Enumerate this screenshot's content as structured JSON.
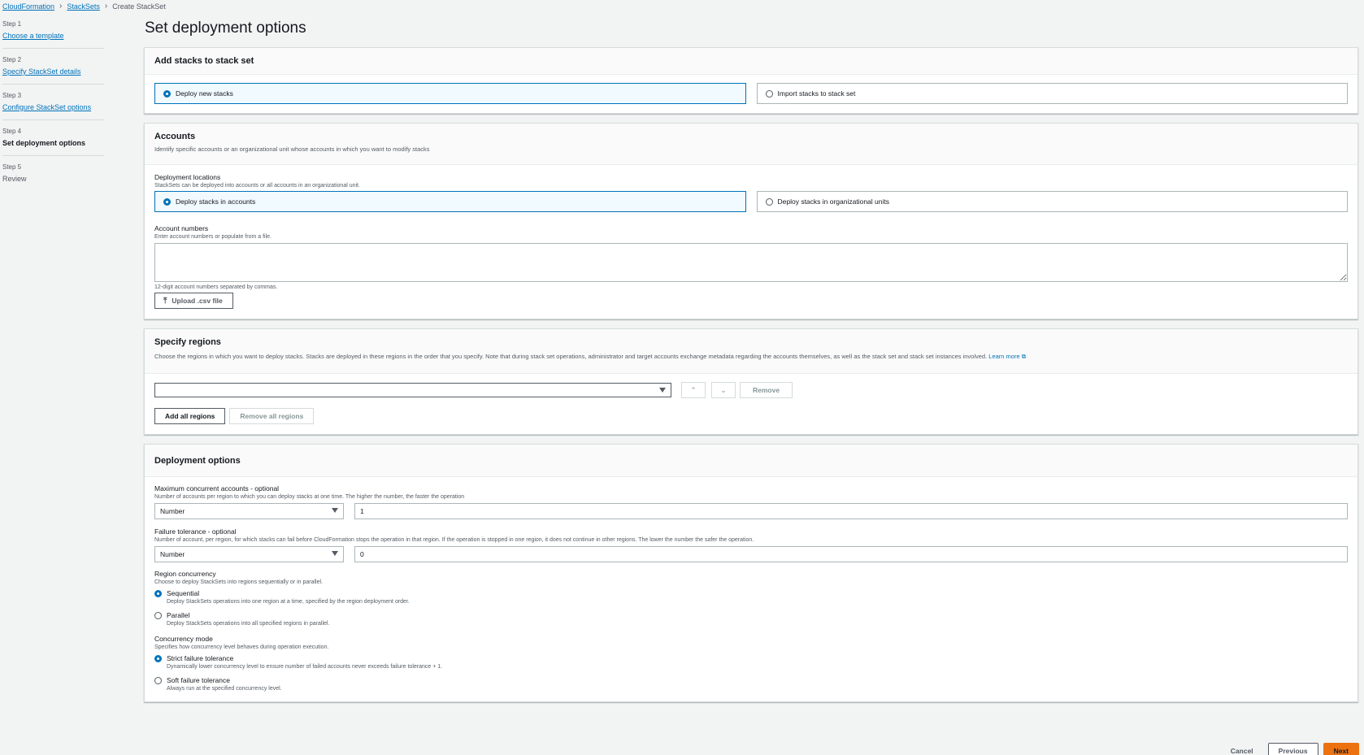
{
  "breadcrumb": {
    "item1": "CloudFormation",
    "item2": "StackSets",
    "current": "Create StackSet"
  },
  "steps": [
    {
      "num": "Step 1",
      "label": "Choose a template"
    },
    {
      "num": "Step 2",
      "label": "Specify StackSet details"
    },
    {
      "num": "Step 3",
      "label": "Configure StackSet options"
    },
    {
      "num": "Step 4",
      "label": "Set deployment options"
    },
    {
      "num": "Step 5",
      "label": "Review"
    }
  ],
  "page_title": "Set deployment options",
  "add_stacks": {
    "title": "Add stacks to stack set",
    "option_deploy": "Deploy new stacks",
    "option_import": "Import stacks to stack set"
  },
  "accounts": {
    "title": "Accounts",
    "desc": "Identify specific accounts or an organizational unit whose accounts in which you want to modify stacks",
    "locations_label": "Deployment locations",
    "locations_desc": "StackSets can be deployed into accounts or all accounts in an organizational unit.",
    "option_accounts": "Deploy stacks in accounts",
    "option_ou": "Deploy stacks in organizational units",
    "numbers_label": "Account numbers",
    "numbers_desc": "Enter account numbers or populate from a file.",
    "numbers_value": "",
    "numbers_constraint": "12-digit account numbers separated by commas.",
    "upload_button": "Upload .csv file"
  },
  "regions": {
    "title": "Specify regions",
    "desc": "Choose the regions in which you want to deploy stacks. Stacks are deployed in these regions in the order that you specify. Note that during stack set operations, administrator and target accounts exchange metadata regarding the accounts themselves, as well as the stack set and stack set instances involved.",
    "learn_more": "Learn more",
    "select_value": "",
    "remove_button": "Remove",
    "add_all_button": "Add all regions",
    "remove_all_button": "Remove all regions"
  },
  "deployment": {
    "title": "Deployment options",
    "max_label": "Maximum concurrent accounts - optional",
    "max_desc": "Number of accounts per region to which you can deploy stacks at one time. The higher the number, the faster the operation",
    "max_type": "Number",
    "max_value": "1",
    "fail_label": "Failure tolerance - optional",
    "fail_desc": "Number of account, per region, for which stacks can fail before CloudFormation stops the operation in that region. If the operation is stopped in one region, it does not continue in other regions. The lower the number the safer the operation.",
    "fail_type": "Number",
    "fail_value": "0",
    "region_conc_label": "Region concurrency",
    "region_conc_desc": "Choose to deploy StackSets into regions sequentially or in parallel.",
    "sequential_label": "Sequential",
    "sequential_desc": "Deploy StackSets operations into one region at a time, specified by the region deployment order.",
    "parallel_label": "Parallel",
    "parallel_desc": "Deploy StackSets operations into all specified regions in parallel.",
    "conc_mode_label": "Concurrency mode",
    "conc_mode_desc": "Specifies how concurrency level behaves during operation execution.",
    "strict_label": "Strict failure tolerance",
    "strict_desc": "Dynamically lower concurrency level to ensure number of failed accounts never exceeds failure tolerance + 1.",
    "soft_label": "Soft failure tolerance",
    "soft_desc": "Always run at the specified concurrency level."
  },
  "footer": {
    "cancel": "Cancel",
    "previous": "Previous",
    "next": "Next"
  },
  "colors": {
    "link": "#0073bb",
    "primary": "#ec7211",
    "selected_bg": "#f1faff"
  }
}
